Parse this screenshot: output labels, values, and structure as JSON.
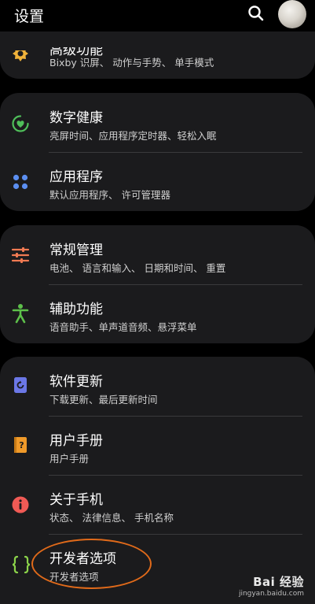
{
  "header": {
    "title": "设置"
  },
  "sections": [
    {
      "items": [
        {
          "title": "高级功能",
          "subtitle": "Bixby 识屏、 动作与手势、 单手模式",
          "icon": "star-gear-icon",
          "color": "#f0b23a"
        }
      ]
    },
    {
      "items": [
        {
          "title": "数字健康",
          "subtitle": "亮屏时间、应用程序定时器、轻松入眠",
          "icon": "digital-wellbeing-icon",
          "color": "#4fbf5a"
        },
        {
          "title": "应用程序",
          "subtitle": "默认应用程序、 许可管理器",
          "icon": "apps-grid-icon",
          "color": "#5b8ef0"
        }
      ]
    },
    {
      "items": [
        {
          "title": "常规管理",
          "subtitle": "电池、 语言和输入、 日期和时间、 重置",
          "icon": "sliders-icon",
          "color": "#f07a52"
        },
        {
          "title": "辅助功能",
          "subtitle": "语音助手、单声道音频、悬浮菜单",
          "icon": "accessibility-icon",
          "color": "#5dc04a"
        }
      ]
    },
    {
      "items": [
        {
          "title": "软件更新",
          "subtitle": "下载更新、最后更新时间",
          "icon": "software-update-icon",
          "color": "#6b77e6"
        },
        {
          "title": "用户手册",
          "subtitle": "用户手册",
          "icon": "user-manual-icon",
          "color": "#f09a2a"
        },
        {
          "title": "关于手机",
          "subtitle": "状态、 法律信息、 手机名称",
          "icon": "info-icon",
          "color": "#f05a55"
        },
        {
          "title": "开发者选项",
          "subtitle": "开发者选项",
          "icon": "developer-braces-icon",
          "color": "#8bd34a"
        }
      ]
    }
  ],
  "watermark": {
    "main": "Bai 经验",
    "sub": "jingyan.baidu.com"
  }
}
